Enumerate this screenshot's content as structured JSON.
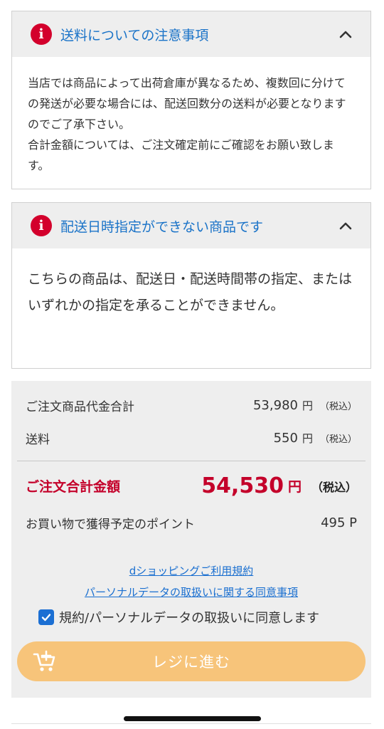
{
  "notices": [
    {
      "title": "送料についての注意事項",
      "body": "当店では商品によって出荷倉庫が異なるため、複数回に分けての発送が必要な場合には、配送回数分の送料が必要となりますのでご了承下さい。",
      "body2": "合計金額については、ご注文確定前にご確認をお願い致します。",
      "icon": "alert-icon",
      "expanded": true
    },
    {
      "title": "配送日時指定ができない商品です",
      "body": "こちらの商品は、配送日・配送時間帯の指定、またはいずれかの指定を承ることができません。",
      "icon": "alert-icon",
      "expanded": true
    }
  ],
  "summary": {
    "subtotal_label": "ご注文商品代金合計",
    "subtotal_value": "53,980",
    "shipping_label": "送料",
    "shipping_value": "550",
    "yen": "円",
    "tax_note": "（税込）",
    "total_label": "ご注文合計金額",
    "total_value": "54,530",
    "points_label": "お買い物で獲得予定のポイント",
    "points_value": "495 P"
  },
  "links": {
    "terms": "dショッピングご利用規約",
    "privacy": "パーソナルデータの取扱いに関する同意事項"
  },
  "agreement": {
    "label": "規約/パーソナルデータの取扱いに同意します",
    "checked": true
  },
  "checkout": {
    "label": "レジに進む",
    "icon": "cart-plus-icon"
  },
  "colors": {
    "accent_red": "#c4002a",
    "link_blue": "#1a6fd0",
    "checkout_bg": "#f7c47a",
    "panel_gray": "#eeeeee"
  }
}
